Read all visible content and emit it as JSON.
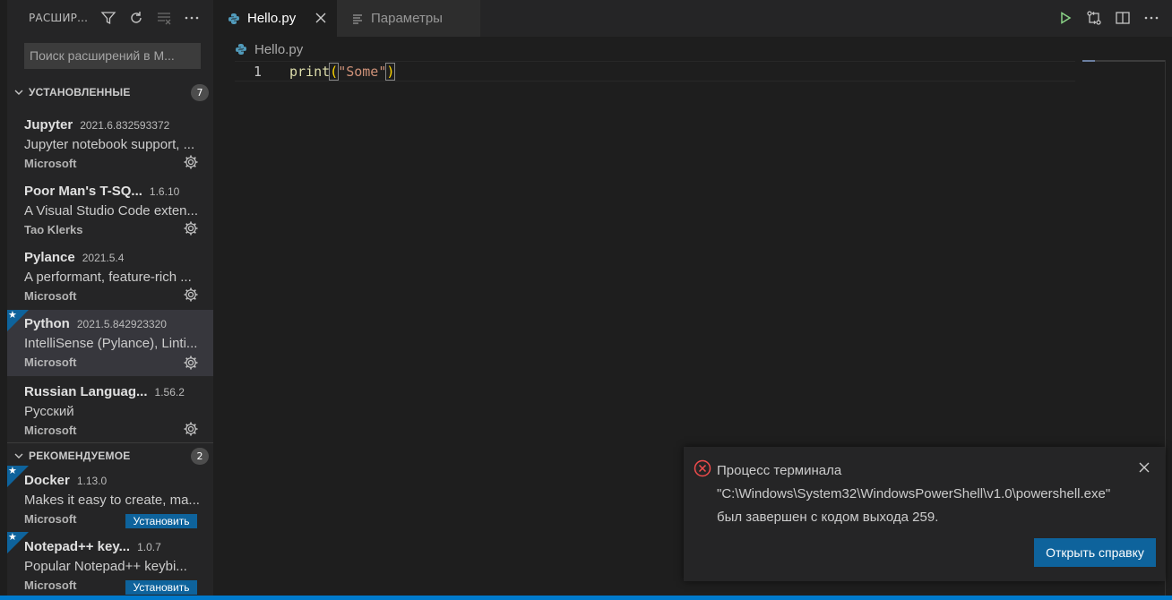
{
  "sidebar": {
    "title": "РАСШИР...",
    "search_placeholder": "Поиск расширений в М...",
    "installed": {
      "title": "УСТАНОВЛЕННЫЕ",
      "count": "7",
      "items": [
        {
          "name": "Jupyter",
          "version": "2021.6.832593372",
          "description": "Jupyter notebook support, ...",
          "publisher": "Microsoft"
        },
        {
          "name": "Poor Man's T-SQ...",
          "version": "1.6.10",
          "description": "A Visual Studio Code exten...",
          "publisher": "Tao Klerks"
        },
        {
          "name": "Pylance",
          "version": "2021.5.4",
          "description": "A performant, feature-rich ...",
          "publisher": "Microsoft"
        },
        {
          "name": "Python",
          "version": "2021.5.842923320",
          "description": "IntelliSense (Pylance), Linti...",
          "publisher": "Microsoft"
        },
        {
          "name": "Russian Languag...",
          "version": "1.56.2",
          "description": "Русский",
          "publisher": "Microsoft"
        }
      ]
    },
    "recommended": {
      "title": "РЕКОМЕНДУЕМОЕ",
      "count": "2",
      "install_label": "Установить",
      "items": [
        {
          "name": "Docker",
          "version": "1.13.0",
          "description": "Makes it easy to create, ma...",
          "publisher": "Microsoft"
        },
        {
          "name": "Notepad++ key...",
          "version": "1.0.7",
          "description": "Popular Notepad++ keybi...",
          "publisher": "Microsoft"
        }
      ]
    }
  },
  "tabs": [
    {
      "label": "Hello.py",
      "icon": "python-icon"
    },
    {
      "label": "Параметры",
      "icon": "settings-file-icon"
    }
  ],
  "breadcrumb": {
    "file": "Hello.py"
  },
  "editor": {
    "line_number": "1",
    "code": {
      "fn": "print",
      "open": "(",
      "str": "\"Some\"",
      "close": ")"
    }
  },
  "notification": {
    "line1": "Процесс терминала",
    "line2": "\"C:\\Windows\\System32\\WindowsPowerShell\\v1.0\\powershell.exe\"",
    "line3": "был завершен с кодом выхода 259.",
    "button": "Открыть справку"
  },
  "colors": {
    "accent": "#007acc",
    "button": "#0e639c",
    "error": "#f14c4c"
  }
}
